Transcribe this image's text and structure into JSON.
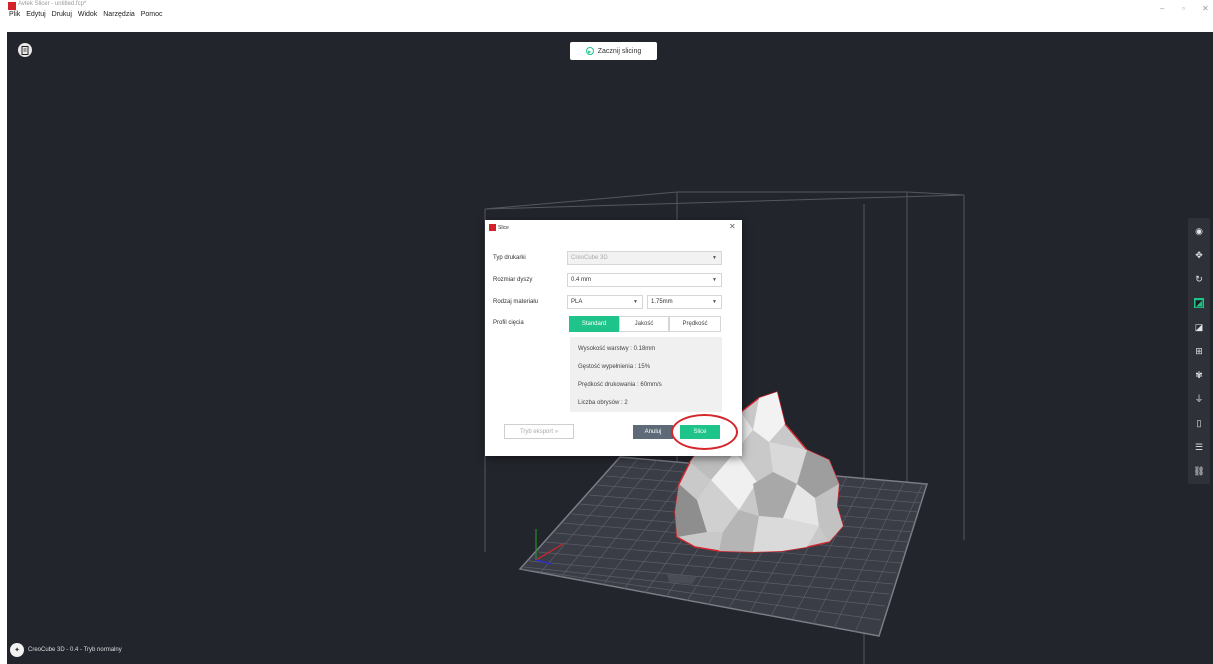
{
  "window": {
    "title": "Avtek Slicer - untitled.fcp*"
  },
  "menu": [
    "Plik",
    "Edytuj",
    "Drukuj",
    "Widok",
    "Narzędzia",
    "Pomoc"
  ],
  "window_controls": {
    "minimize": "–",
    "maximize": "▫",
    "close": "✕"
  },
  "toolbar": {
    "start_slicing_label": "Zacznij slicing"
  },
  "status_bar": {
    "text": "CreoCube 3D - 0.4 - Tryb normalny"
  },
  "right_toolbar": {
    "icons": [
      "eye-icon",
      "move-icon",
      "rotate-icon",
      "scale-icon",
      "mirror-icon",
      "add-icon",
      "support-icon",
      "flatten-icon",
      "cylinder-icon",
      "settings-sliders-icon",
      "link-icon"
    ]
  },
  "dialog": {
    "title": "Slice",
    "close": "✕",
    "printer_type_label": "Typ drukarki",
    "printer_type_value": "CreoCube 3D",
    "nozzle_label": "Rozmiar dyszy",
    "nozzle_value": "0.4 mm",
    "material_label": "Rodzaj materiału",
    "material_value": "PLA",
    "filament_value": "1.75mm",
    "profile_label": "Profil cięcia",
    "profile_tabs": [
      "Standard",
      "Jakość",
      "Prędkość"
    ],
    "profile_active": "Standard",
    "info": [
      "Wysokość warstwy : 0.18mm",
      "Gęstość wypełnienia : 15%",
      "Prędkość drukowania : 60mm/s",
      "Liczba obrysów : 2"
    ],
    "export_button": "Tryb eksport »",
    "cancel_button": "Anuluj",
    "slice_button": "Slice"
  },
  "colors": {
    "viewport_bg": "#23252d",
    "accent": "#1fc48a",
    "highlight_ring": "#d5262c",
    "model_outline": "#d5262c",
    "brand": "#d2232a"
  }
}
